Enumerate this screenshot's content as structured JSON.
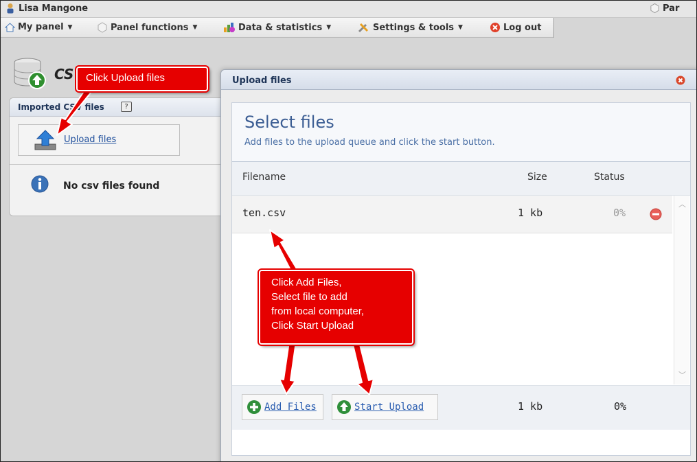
{
  "user": {
    "name": "Lisa Mangone",
    "right_label": "Par"
  },
  "menu": {
    "my_panel": "My panel",
    "panel_functions": "Panel functions",
    "data_statistics": "Data & statistics",
    "settings_tools": "Settings & tools",
    "log_out": "Log out"
  },
  "left": {
    "title": "CSV",
    "panel_header": "Imported CSV files",
    "help": "?",
    "upload_link": "Upload files",
    "empty_message": "No csv files found"
  },
  "dialog": {
    "title": "Upload files",
    "heading": "Select files",
    "subheading": "Add files to the upload queue and click the start button.",
    "columns": {
      "filename": "Filename",
      "size": "Size",
      "status": "Status"
    },
    "files": [
      {
        "name": "ten.csv",
        "size": "1 kb",
        "status": "0%"
      }
    ],
    "buttons": {
      "add_files": "Add Files",
      "start_upload": "Start Upload"
    },
    "totals": {
      "size": "1 kb",
      "status": "0%"
    }
  },
  "annotations": {
    "upload_hint": "Click Upload files",
    "add_hint": [
      "Click Add Files,",
      "Select file to add",
      "from local computer,",
      "Click Start Upload"
    ]
  },
  "colors": {
    "annotation_red": "#e60000",
    "heading_blue": "#3b5d93",
    "link_blue": "#2a5db0"
  }
}
